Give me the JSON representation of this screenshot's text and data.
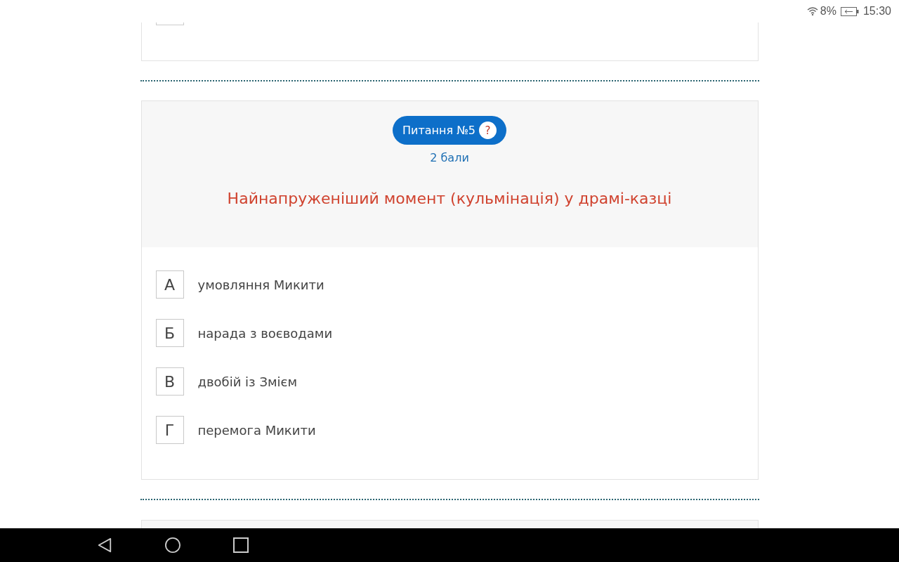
{
  "status_bar": {
    "battery": "8%",
    "time": "15:30"
  },
  "question": {
    "badge": "Питання №5",
    "help": "?",
    "points": "2 бали",
    "text": "Найнапруженіший момент (кульмінація) у драмі-казці",
    "options": [
      {
        "letter": "А",
        "text": "умовляння Микити"
      },
      {
        "letter": "Б",
        "text": "нарада з воєводами"
      },
      {
        "letter": "В",
        "text": "двобій із Змієм"
      },
      {
        "letter": "Г",
        "text": "перемога Микити"
      }
    ]
  }
}
